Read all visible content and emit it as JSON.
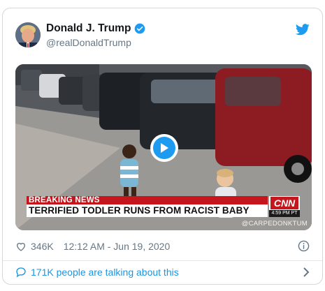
{
  "tweet": {
    "display_name": "Donald J. Trump",
    "handle": "@realDonaldTrump",
    "verified_icon": "verified-badge-icon",
    "brand_icon": "twitter-bird-icon",
    "accent_color": "#1d9bf0"
  },
  "video": {
    "chyron_top": "BREAKING NEWS",
    "chyron_headline": "TERRIFIED TODLER RUNS FROM RACIST BABY",
    "network_logo": "CNN",
    "network_time": "4:59 PM PT",
    "watermark": "@CARPEDONKTUM",
    "play_icon": "play-icon"
  },
  "meta": {
    "likes": "346K",
    "timestamp": "12:12 AM - Jun 19, 2020",
    "like_icon": "heart-icon",
    "info_icon": "info-icon"
  },
  "footer": {
    "conversation_text": "171K people are talking about this",
    "bubble_icon": "speech-bubble-icon",
    "chevron_icon": "chevron-right-icon"
  }
}
